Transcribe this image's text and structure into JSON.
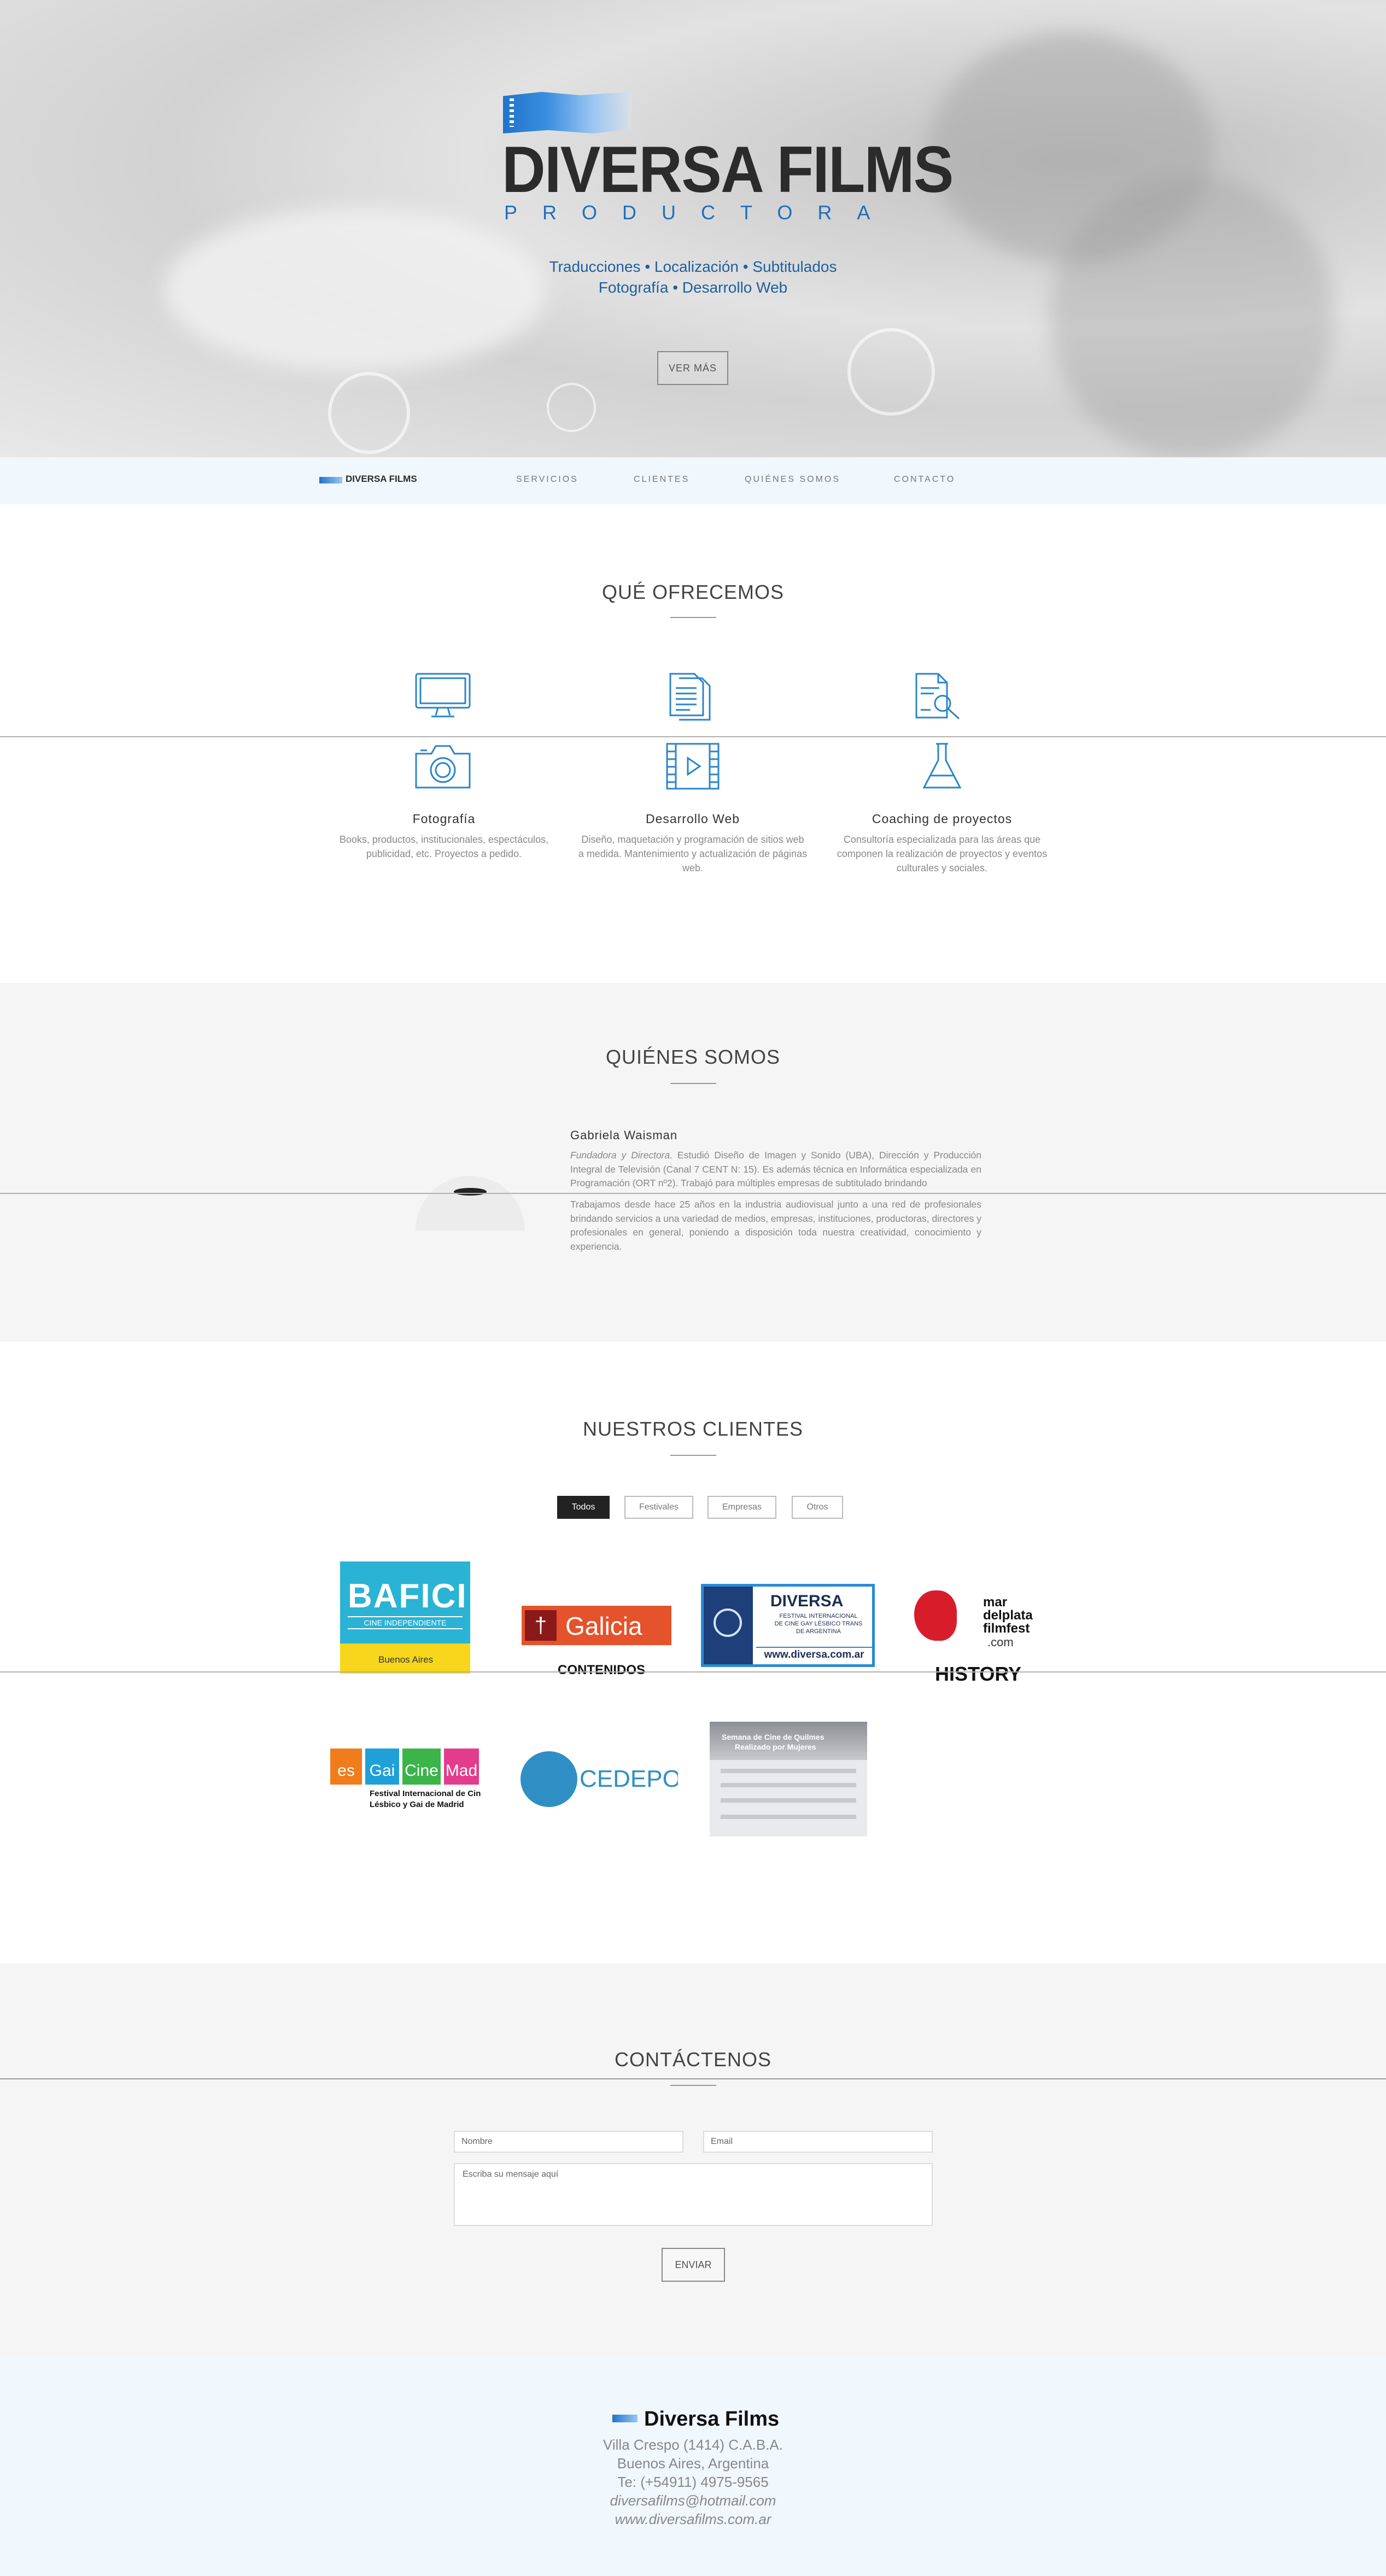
{
  "hero": {
    "brand_title": "DIVERSA FILMS",
    "brand_subtitle": "PRODUCTORA",
    "tagline_1": "Traducciones • Localización • Subtitulados",
    "tagline_2": "Fotografía • Desarrollo Web",
    "cta_label": "VER MÁS"
  },
  "nav": {
    "logo": "DIVERSA FILMS",
    "items": [
      "SERVICIOS",
      "CLIENTES",
      "QUIÉNES SOMOS",
      "CONTACTO"
    ]
  },
  "services": {
    "title": "QUÉ OFRECEMOS",
    "icons_row1": [
      "monitor-icon",
      "document-icon",
      "document-search-icon"
    ],
    "icons_row2": [
      "camera-icon",
      "film-play-icon",
      "flask-icon"
    ],
    "items": [
      {
        "title": "Fotografía",
        "desc": "Books, productos, institucionales, espectáculos, publicidad, etc. Proyectos a pedido."
      },
      {
        "title": "Desarrollo Web",
        "desc": "Diseño, maquetación y programación de sitios web a medida. Mantenimiento y actualización de páginas web."
      },
      {
        "title": "Coaching de proyectos",
        "desc": "Consultoría especializada para las áreas que componen la realización de proyectos y eventos culturales y sociales."
      }
    ]
  },
  "about": {
    "title": "QUIÉNES SOMOS",
    "name": "Gabriela Waisman",
    "role": "Fundadora y Directora.",
    "bio_1": "Estudió Diseño de Imagen y Sonido (UBA), Dirección y Producción Integral de Televisión (Canal 7 CENT N: 15). Es además técnica en Informática especializada en Programación (ORT nº2). Trabajó para múltiples empresas de subtitulado brindando",
    "bio_2": "Trabajamos desde hace 25 años en la industria audiovisual junto a una red de profesionales brindando servicios a una variedad de medios, empresas, instituciones, productoras, directores y profesionales en general, poniendo a disposición toda nuestra creatividad, conocimiento y experiencia."
  },
  "clients": {
    "title": "NUESTROS CLIENTES",
    "filters": [
      "Todos",
      "Festivales",
      "Empresas",
      "Otros"
    ],
    "logos": {
      "bafici": {
        "name": "BAFICI",
        "line": "CINE INDEPENDIENTE",
        "footer": "Buenos Aires"
      },
      "galicia": {
        "name": "Galicia"
      },
      "contenidos": {
        "name": "CONTENIDOS"
      },
      "diversa_fest": {
        "name": "DIVERSA",
        "line1": "FESTIVAL INTERNACIONAL",
        "line2": "DE CINE GAY LÉSBICO TRANS",
        "line3": "DE ARGENTINA",
        "url": "www.diversa.com.ar"
      },
      "mardelplata": {
        "line1": "mar",
        "line2": "delplata",
        "line3": "filmfest",
        "line4": ".com"
      },
      "history": {
        "name": "HISTORY"
      },
      "lesgaicinemad": {
        "tiles": [
          "es",
          "Gai",
          "Cine",
          "Mad"
        ],
        "line1": "Festival Internacional de Cine",
        "line2": "Lésbico y Gai de Madrid"
      },
      "cedepo": {
        "name": "CEDEPO"
      },
      "muestra": {
        "line1": "Semana de Cine de Quilmes",
        "line2": "Realizado por Mujeres"
      }
    }
  },
  "contact": {
    "title": "CONTÁCTENOS",
    "name_placeholder": "Nombre",
    "email_placeholder": "Email",
    "message_placeholder": "Escriba su mensaje aquí",
    "send_label": "ENVIAR"
  },
  "footer": {
    "brand": "Diversa Films",
    "address_1": "Villa Crespo (1414) C.A.B.A.",
    "address_2": "Buenos Aires, Argentina",
    "phone": "Te: (+54911) 4975-9565",
    "email": "diversafilms@hotmail.com",
    "web": "www.diversafilms.com.ar"
  },
  "colors": {
    "brand_blue": "#1f74c9",
    "nav_bg": "#f0f7fd",
    "section_gray": "#f5f5f5"
  }
}
